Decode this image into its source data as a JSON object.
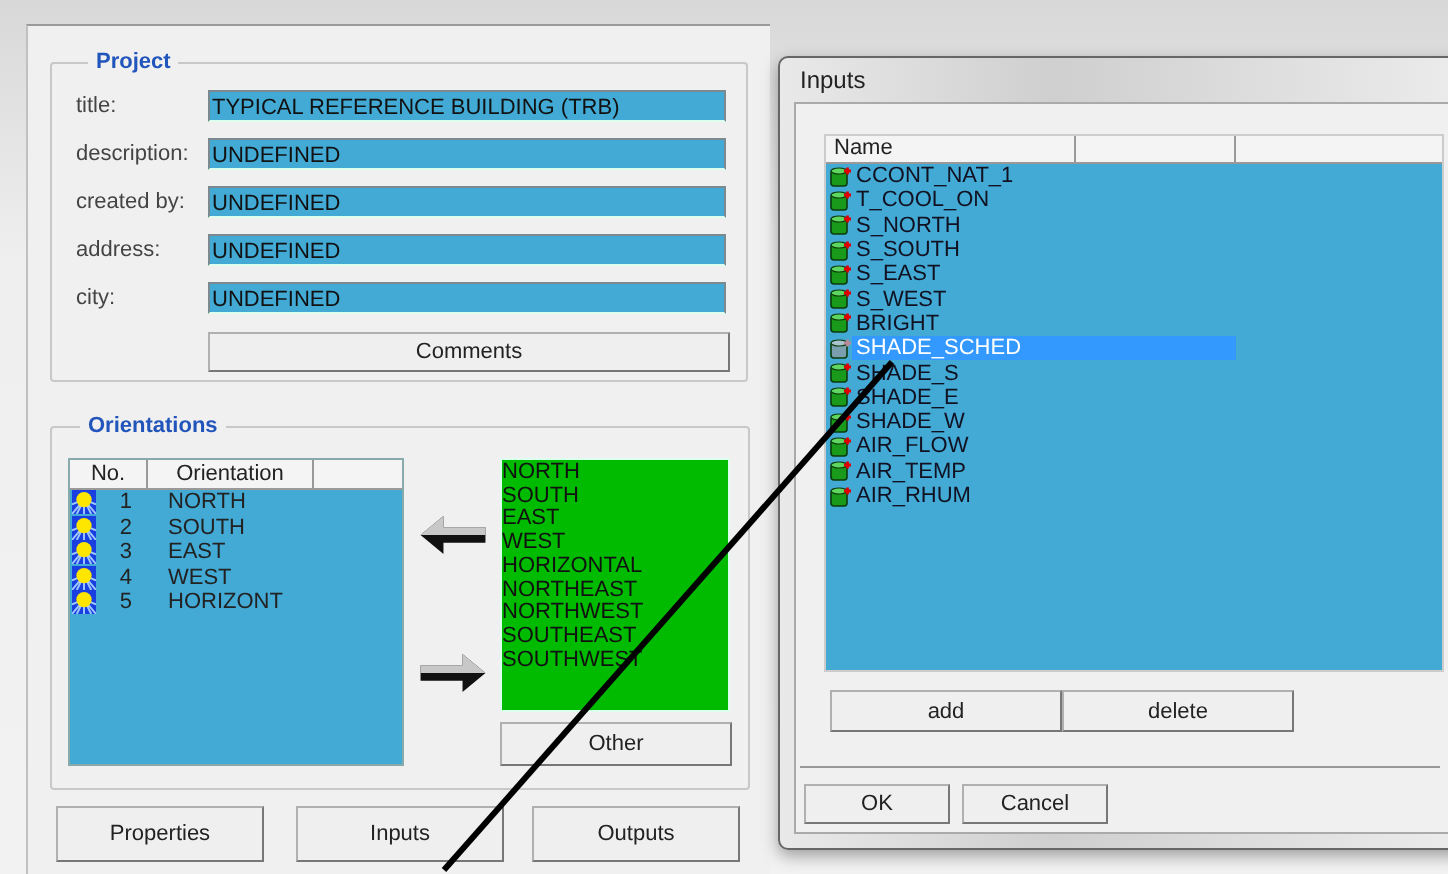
{
  "project": {
    "legend": "Project",
    "fields": [
      {
        "label": "title:",
        "value": "TYPICAL REFERENCE BUILDING (TRB)"
      },
      {
        "label": "description:",
        "value": "UNDEFINED"
      },
      {
        "label": "created by:",
        "value": "UNDEFINED"
      },
      {
        "label": "address:",
        "value": "UNDEFINED"
      },
      {
        "label": "city:",
        "value": "UNDEFINED"
      }
    ],
    "comments_button": "Comments"
  },
  "orientations": {
    "legend": "Orientations",
    "columns": [
      "No.",
      "Orientation"
    ],
    "rows": [
      {
        "no": "1",
        "name": "NORTH"
      },
      {
        "no": "2",
        "name": "SOUTH"
      },
      {
        "no": "3",
        "name": "EAST"
      },
      {
        "no": "4",
        "name": "WEST"
      },
      {
        "no": "5",
        "name": "HORIZONT"
      }
    ],
    "available": [
      "NORTH",
      "SOUTH",
      "EAST",
      "WEST",
      "HORIZONTAL",
      "NORTHEAST",
      "NORTHWEST",
      "SOUTHEAST",
      "SOUTHWEST"
    ],
    "other_button": "Other"
  },
  "bottom_buttons": [
    "Properties",
    "Inputs",
    "Outputs"
  ],
  "inputs_dialog": {
    "title": "Inputs",
    "column": "Name",
    "items": [
      {
        "name": "CCONT_NAT_1",
        "selected": false
      },
      {
        "name": "T_COOL_ON",
        "selected": false
      },
      {
        "name": "S_NORTH",
        "selected": false
      },
      {
        "name": "S_SOUTH",
        "selected": false
      },
      {
        "name": "S_EAST",
        "selected": false
      },
      {
        "name": "S_WEST",
        "selected": false
      },
      {
        "name": "BRIGHT",
        "selected": false
      },
      {
        "name": "SHADE_SCHED",
        "selected": true
      },
      {
        "name": "SHADE_S",
        "selected": false
      },
      {
        "name": "SHADE_E",
        "selected": false
      },
      {
        "name": "SHADE_W",
        "selected": false
      },
      {
        "name": "AIR_FLOW",
        "selected": false
      },
      {
        "name": "AIR_TEMP",
        "selected": false
      },
      {
        "name": "AIR_RHUM",
        "selected": false
      }
    ],
    "list_buttons": [
      "add",
      "delete"
    ],
    "buttons": [
      "OK",
      "Cancel"
    ]
  }
}
